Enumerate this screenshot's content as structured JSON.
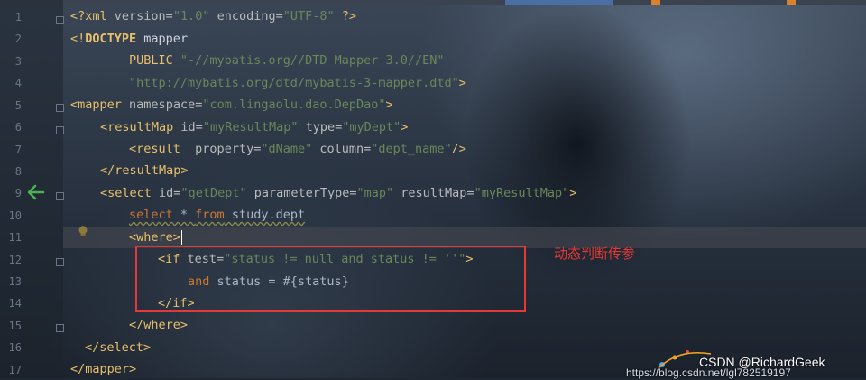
{
  "editor": {
    "lines": [
      {
        "num": "1"
      },
      {
        "num": "2"
      },
      {
        "num": "3"
      },
      {
        "num": "4"
      },
      {
        "num": "5"
      },
      {
        "num": "6"
      },
      {
        "num": "7"
      },
      {
        "num": "8"
      },
      {
        "num": "9"
      },
      {
        "num": "10"
      },
      {
        "num": "11"
      },
      {
        "num": "12"
      },
      {
        "num": "13"
      },
      {
        "num": "14"
      },
      {
        "num": "15"
      },
      {
        "num": "16"
      },
      {
        "num": "17"
      }
    ],
    "code": {
      "l1": {
        "open": "<?",
        "name": "xml",
        "a1": " version=",
        "v1": "\"1.0\"",
        "a2": " encoding=",
        "v2": "\"UTF-8\"",
        "close": " ?>"
      },
      "l2": {
        "open": "<!",
        "kw": "DOCTYPE",
        "rest": " mapper"
      },
      "l3": {
        "kw": "PUBLIC",
        "str": " \"-//mybatis.org//DTD Mapper 3.0//EN\""
      },
      "l4": {
        "str": "\"http://mybatis.org/dtd/mybatis-3-mapper.dtd\"",
        "close": ">"
      },
      "l5": {
        "open": "<",
        "tag": "mapper",
        "a1": " namespace=",
        "v1": "\"com.lingaolu.dao.DepDao\"",
        "close": ">"
      },
      "l6": {
        "open": "<",
        "tag": "resultMap",
        "a1": " id=",
        "v1": "\"myResultMap\"",
        "a2": " type=",
        "v2": "\"myDept\"",
        "close": ">"
      },
      "l7": {
        "open": "<",
        "tag": "result",
        "a1": "  property=",
        "v1": "\"dName\"",
        "a2": " column=",
        "v2": "\"dept_name\"",
        "close": "/>"
      },
      "l8": {
        "open": "</",
        "tag": "resultMap",
        "close": ">"
      },
      "l9": {
        "open": "<",
        "tag": "select",
        "a1": " id=",
        "v1": "\"getDept\"",
        "a2": " parameterType=",
        "v2": "\"map\"",
        "a3": " resultMap=",
        "v3": "\"myResultMap\"",
        "close": ">"
      },
      "l10": {
        "kw1": "select",
        "mid": " * ",
        "kw2": "from",
        "rest": " study.dept"
      },
      "l11": {
        "open": "<",
        "tag": "where",
        "close": ">"
      },
      "l12": {
        "open": "<",
        "tag": "if",
        "a1": " test=",
        "v1": "\"status != null and status != ''\"",
        "close": ">"
      },
      "l13": {
        "kw": "and",
        "rest": " status = #{status}"
      },
      "l14": {
        "open": "</",
        "tag": "if",
        "close": ">"
      },
      "l15": {
        "open": "</",
        "tag": "where",
        "close": ">"
      },
      "l16": {
        "open": "</",
        "tag": "select",
        "close": ">"
      },
      "l17": {
        "open": "</",
        "tag": "mapper",
        "close": ">"
      }
    }
  },
  "annotation": {
    "label": "动态判断传参",
    "color": "#e53935"
  },
  "watermark": {
    "brand": "CSDN @RichardGeek",
    "url": "https://blog.csdn.net/lgl782519197"
  },
  "icons": {
    "gutter_arrow": "green-left-arrow-icon",
    "intention": "lightbulb-icon"
  },
  "colors": {
    "arrow": "#4caf50",
    "bulb": "#f5c518",
    "annotation_box": "#e53935"
  }
}
